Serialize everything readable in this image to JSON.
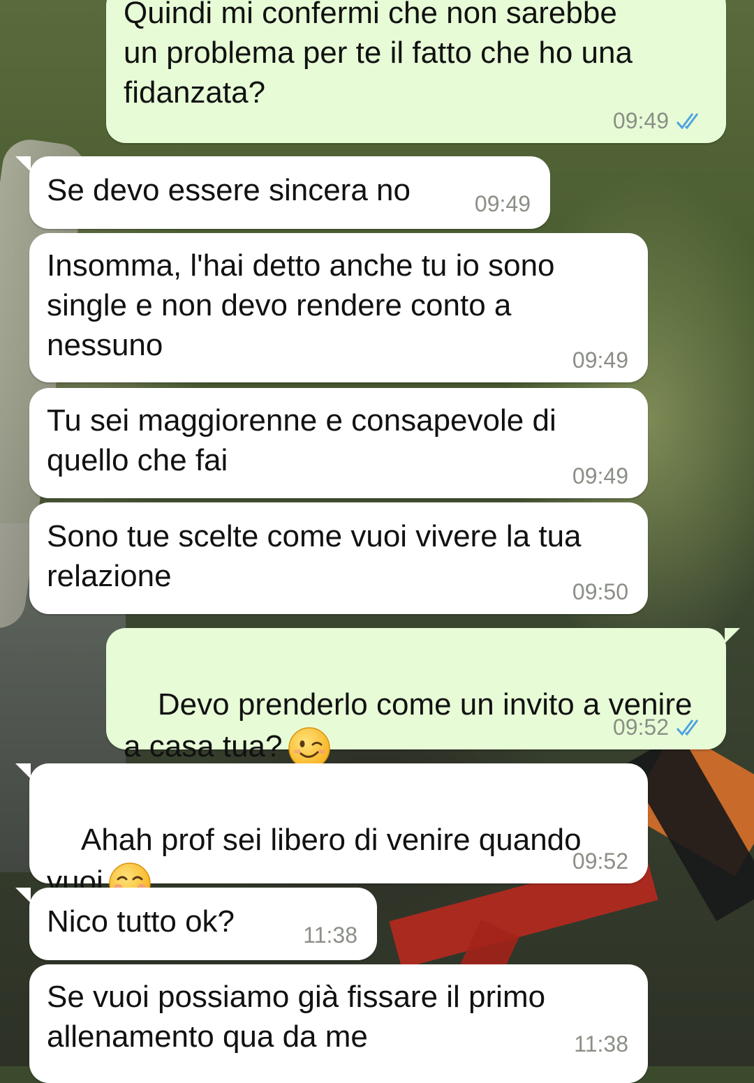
{
  "messages": [
    {
      "text": "Quindi mi confermi che non sarebbe\nun problema per te il fatto che ho una\nfidanzata?",
      "time": "09:49",
      "direction": "out",
      "status": "read"
    },
    {
      "text": "Se devo essere sincera no",
      "time": "09:49",
      "direction": "in"
    },
    {
      "text": "Insomma, l'hai detto anche tu io sono\nsingle e non devo rendere conto a\nnessuno",
      "time": "09:49",
      "direction": "in"
    },
    {
      "text": "Tu sei maggiorenne e consapevole di\nquello che fai",
      "time": "09:49",
      "direction": "in"
    },
    {
      "text": "Sono tue scelte come vuoi vivere la tua\nrelazione",
      "time": "09:50",
      "direction": "in"
    },
    {
      "text": "Devo prenderlo come un invito a venire\na casa tua?",
      "time": "09:52",
      "direction": "out",
      "status": "read",
      "emoji": "winking-face"
    },
    {
      "text": "Ahah prof sei libero di venire quando\nvuoi",
      "time": "09:52",
      "direction": "in",
      "emoji": "smiling-face"
    },
    {
      "text": "Nico tutto ok?",
      "time": "11:38",
      "direction": "in"
    },
    {
      "text": "Se vuoi possiamo già fissare il primo\nallenamento qua da me",
      "time": "11:38",
      "direction": "in"
    }
  ],
  "colors": {
    "incoming_bubble": "#ffffff",
    "outgoing_bubble": "#e7fcd6",
    "read_ticks": "#4fa3e0",
    "timestamp": "#8a8f86"
  }
}
